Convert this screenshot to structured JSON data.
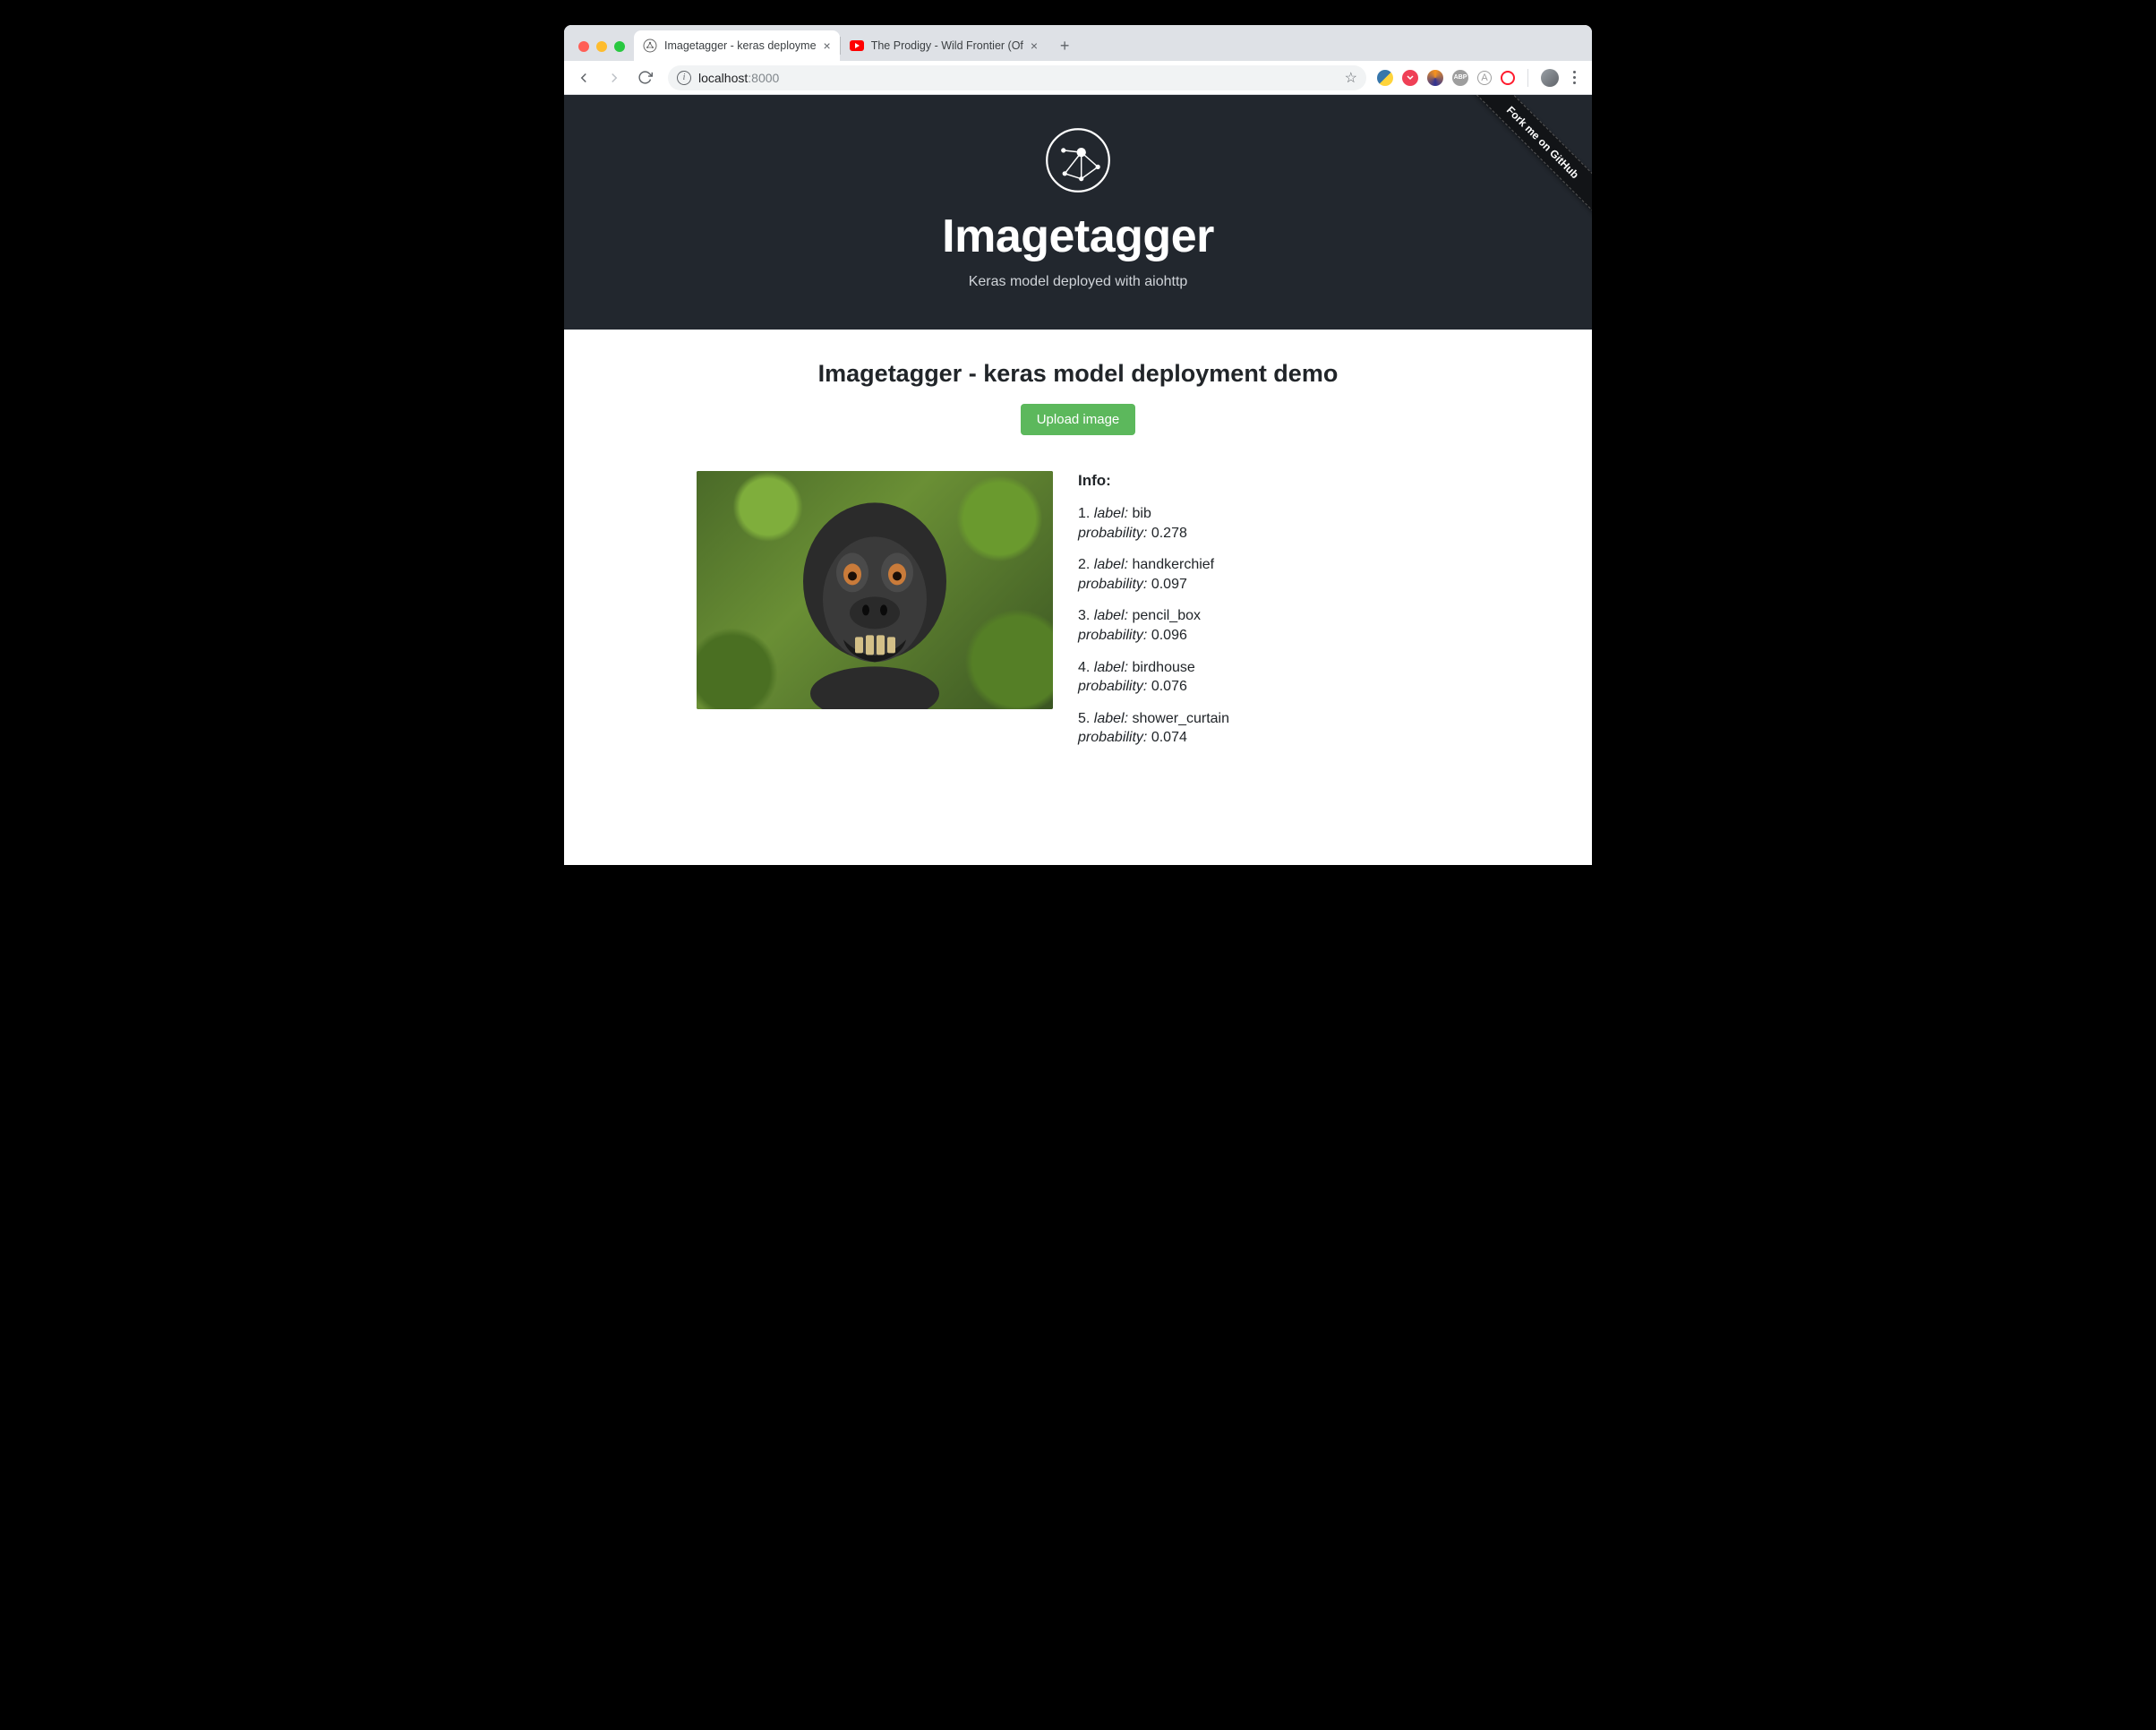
{
  "browser": {
    "tabs": [
      {
        "title": "Imagetagger - keras deployme",
        "favicon": "network-icon",
        "active": true
      },
      {
        "title": "The Prodigy - Wild Frontier (Of",
        "favicon": "youtube-icon",
        "active": false
      }
    ],
    "url_host": "localhost",
    "url_port": ":8000"
  },
  "hero": {
    "title": "Imagetagger",
    "subtitle": "Keras model deployed with aiohttp",
    "ribbon": "Fork me on GitHub"
  },
  "main": {
    "heading": "Imagetagger - keras model deployment demo",
    "upload_label": "Upload image",
    "info_heading": "Info:",
    "label_word": "label:",
    "prob_word": "probability:",
    "predictions": [
      {
        "rank": "1.",
        "label": "bib",
        "probability": "0.278"
      },
      {
        "rank": "2.",
        "label": "handkerchief",
        "probability": "0.097"
      },
      {
        "rank": "3.",
        "label": "pencil_box",
        "probability": "0.096"
      },
      {
        "rank": "4.",
        "label": "birdhouse",
        "probability": "0.076"
      },
      {
        "rank": "5.",
        "label": "shower_curtain",
        "probability": "0.074"
      }
    ]
  }
}
